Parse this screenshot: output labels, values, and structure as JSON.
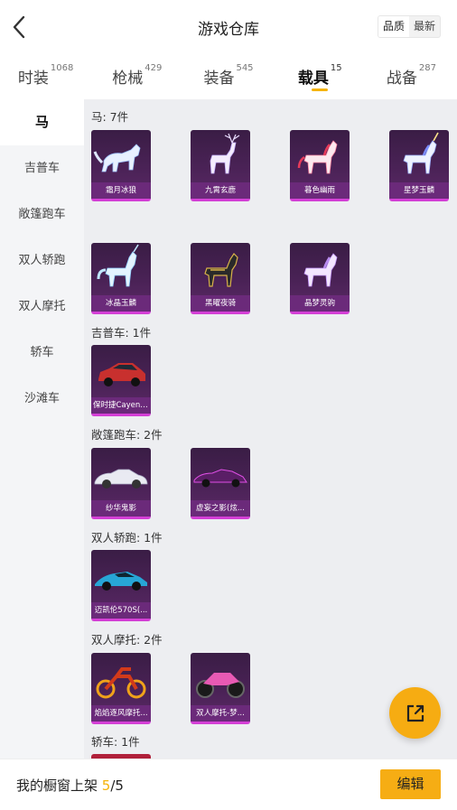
{
  "header": {
    "title": "游戏仓库",
    "sort": [
      "品质",
      "最新"
    ]
  },
  "tabs": [
    {
      "label": "时装",
      "count": "1068",
      "active": false
    },
    {
      "label": "枪械",
      "count": "429",
      "active": false
    },
    {
      "label": "装备",
      "count": "545",
      "active": false
    },
    {
      "label": "载具",
      "count": "15",
      "active": true
    },
    {
      "label": "战备",
      "count": "287",
      "active": false
    }
  ],
  "leftnav": [
    "马",
    "吉普车",
    "敞篷跑车",
    "双人轿跑",
    "双人摩托",
    "轿车",
    "沙滩车"
  ],
  "sections": [
    {
      "title": "马: 7件",
      "items": [
        "霜月冰狼",
        "九霄玄鹿",
        "暮色幽雨",
        "星梦玉麟",
        "冰晶玉麟",
        "黑曜夜骑",
        "晶梦灵驹"
      ]
    },
    {
      "title": "吉普车: 1件",
      "items": [
        "保时捷Cayenne"
      ]
    },
    {
      "title": "敞篷跑车: 2件",
      "items": [
        "纱华鬼影",
        "虚妄之影(炫..."
      ]
    },
    {
      "title": "双人轿跑: 1件",
      "items": [
        "迈凯伦570S(..."
      ]
    },
    {
      "title": "双人摩托: 2件",
      "items": [
        "焰焰逐风摩托...",
        "双人摩托-梦..."
      ]
    },
    {
      "title": "轿车: 1件",
      "items": []
    }
  ],
  "colors": {
    "accent": "#f5b30a",
    "card_bg": "#4a2256",
    "card_label": "#6b2a7a",
    "card_border": "#d43fd6"
  },
  "icons": {
    "back": "chevron-left-icon",
    "share": "share-external-icon"
  },
  "bottom": {
    "shelf_label": "我的橱窗上架",
    "shelf_current": "5",
    "shelf_sep": "/",
    "shelf_total": "5",
    "edit_label": "编辑"
  }
}
